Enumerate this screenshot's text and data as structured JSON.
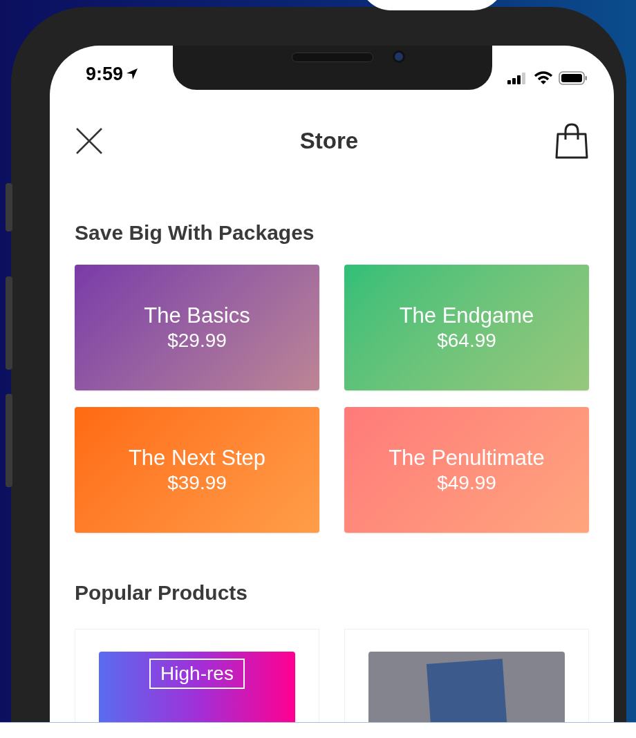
{
  "status_bar": {
    "time": "9:59"
  },
  "nav": {
    "title": "Store"
  },
  "packages": {
    "title": "Save Big With Packages",
    "items": [
      {
        "name": "The Basics",
        "price": "$29.99",
        "color": "#7a3aa8"
      },
      {
        "name": "The Endgame",
        "price": "$64.99",
        "color": "#2fbf78"
      },
      {
        "name": "The Next Step",
        "price": "$39.99",
        "color": "#ff6a10"
      },
      {
        "name": "The Penultimate",
        "price": "$49.99",
        "color": "#ff7a7a"
      }
    ]
  },
  "products": {
    "title": "Popular Products",
    "items": [
      {
        "kind": "text-tile",
        "label": "High-res"
      },
      {
        "kind": "photo"
      }
    ]
  }
}
